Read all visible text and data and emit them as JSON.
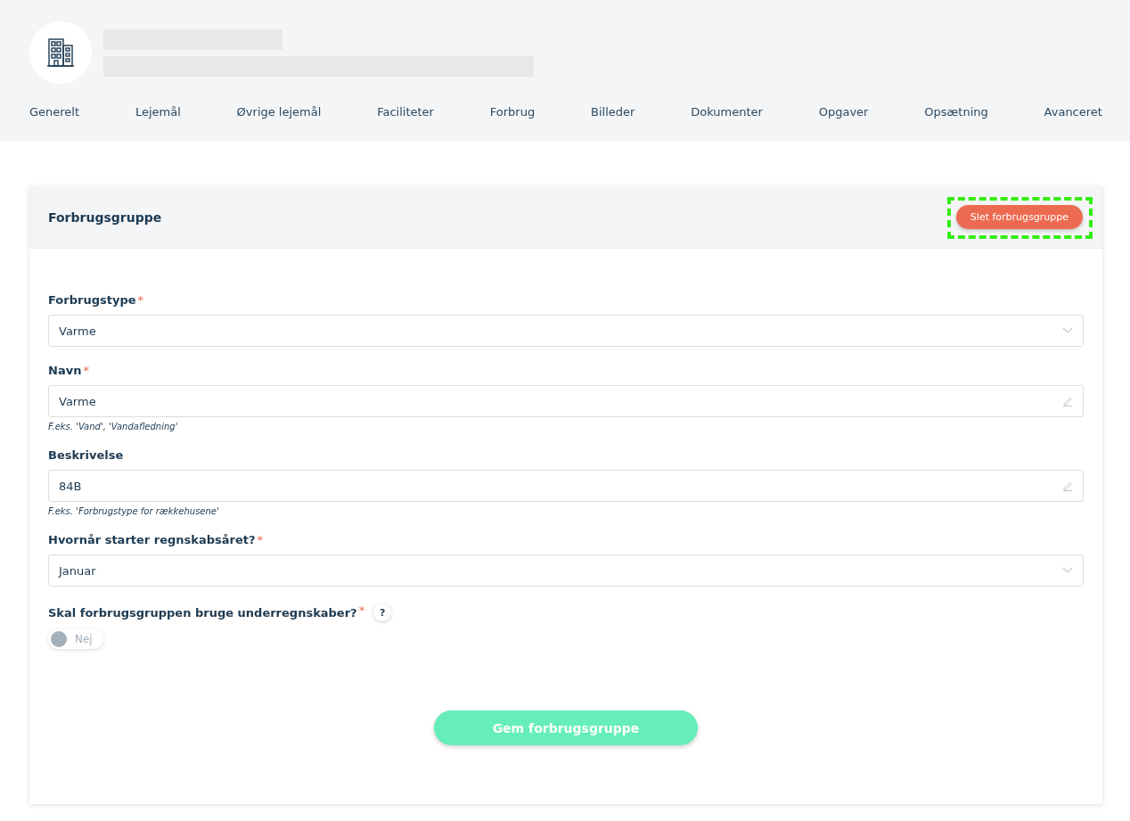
{
  "tabs": [
    {
      "label": "Generelt"
    },
    {
      "label": "Lejemål"
    },
    {
      "label": "Øvrige lejemål"
    },
    {
      "label": "Faciliteter"
    },
    {
      "label": "Forbrug"
    },
    {
      "label": "Billeder"
    },
    {
      "label": "Dokumenter"
    },
    {
      "label": "Opgaver"
    },
    {
      "label": "Opsætning"
    },
    {
      "label": "Avanceret"
    }
  ],
  "card": {
    "title": "Forbrugsgruppe",
    "delete_button": {
      "label": "Slet forbrugsgruppe",
      "highlighted": true
    },
    "fields": [
      {
        "kind": "select",
        "label": "Forbrugstype",
        "required_mark": "*",
        "value": "Varme"
      },
      {
        "kind": "text",
        "label": "Navn",
        "required_mark": "*",
        "value": "Varme",
        "hint": "F.eks. 'Vand', 'Vandafledning'"
      },
      {
        "kind": "text",
        "label": "Beskrivelse",
        "value": "84B",
        "hint": "F.eks. 'Forbrugstype for rækkehusene'"
      },
      {
        "kind": "select",
        "label": "Hvornår starter regnskabsåret?",
        "required_mark": "*",
        "value": "Januar"
      },
      {
        "kind": "toggle",
        "label": "Skal forbrugsgruppen bruge underregnskaber?",
        "required_mark": "*",
        "help": "?",
        "on": false,
        "state_label": "Nej"
      }
    ],
    "save_button": {
      "label": "Gem forbrugsgruppe"
    }
  }
}
